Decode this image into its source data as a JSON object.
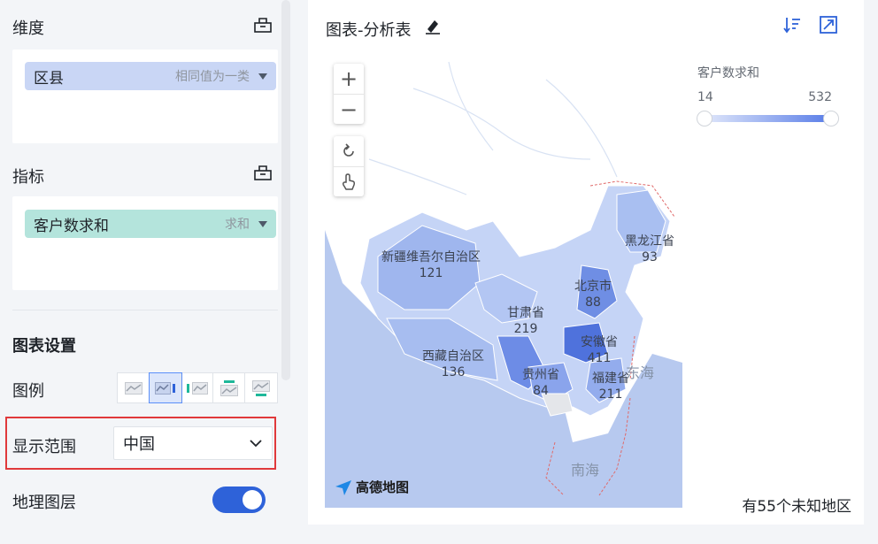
{
  "left": {
    "dimension": {
      "title": "维度",
      "chip_label": "区县",
      "chip_agg": "相同值为一类",
      "chip_color": "#c9d6f5"
    },
    "measure": {
      "title": "指标",
      "chip_label": "客户数求和",
      "chip_agg": "求和",
      "chip_color": "#b4e4dc"
    },
    "chart_settings_title": "图表设置",
    "legend_label": "图例",
    "legend_options": [
      "none",
      "right",
      "left",
      "top",
      "bottom"
    ],
    "legend_selected": "right",
    "display_range": {
      "label": "显示范围",
      "value": "中国"
    },
    "geo_layer": {
      "label": "地理图层",
      "enabled": true
    }
  },
  "panel": {
    "title": "图表-分析表",
    "map": {
      "provinces": [
        {
          "name": "新疆维吾尔自治区",
          "value": "121"
        },
        {
          "name": "西藏自治区",
          "value": "136"
        },
        {
          "name": "甘肃省",
          "value": "219"
        },
        {
          "name": "北京市",
          "value": "88"
        },
        {
          "name": "黑龙江省",
          "value": "93"
        },
        {
          "name": "安徽省",
          "value": "411"
        },
        {
          "name": "贵州省",
          "value": "84"
        },
        {
          "name": "福建省",
          "value": "211"
        }
      ],
      "seas": [
        "东海",
        "南海"
      ],
      "logo": "高德地图"
    },
    "visual_map": {
      "title": "客户数求和",
      "min": "14",
      "max": "532"
    },
    "unknown_regions": "有55个未知地区"
  }
}
